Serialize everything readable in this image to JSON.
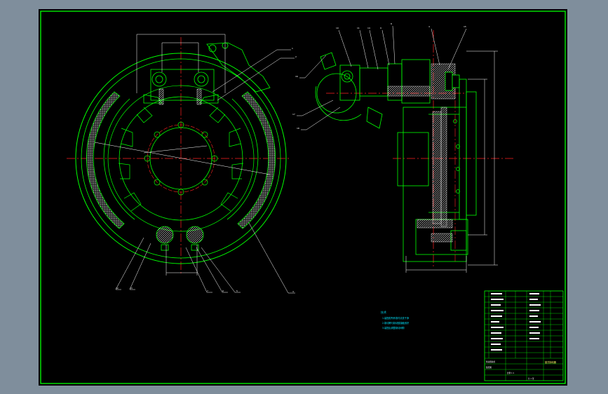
{
  "colors": {
    "background": "#7f8e9c",
    "canvas": "#000000",
    "outline": "#00ff00",
    "centerline": "#ff2020",
    "leader": "#ffffff",
    "hatch": "#e8e8e8",
    "note": "#00e5ff",
    "title_block_text": "#ffff66"
  },
  "technical_notes": {
    "title": "技术",
    "lines": [
      "1.装配前所有零件清洗干净",
      "2.制动蹄与制动鼓接触良好",
      "3.装配后调整制动间隙"
    ]
  },
  "title_block": {
    "drawing_name": "鼓式制动器",
    "cells": [
      "制动器总成",
      "装配图",
      "比例 1:1",
      "共 1 张"
    ]
  }
}
